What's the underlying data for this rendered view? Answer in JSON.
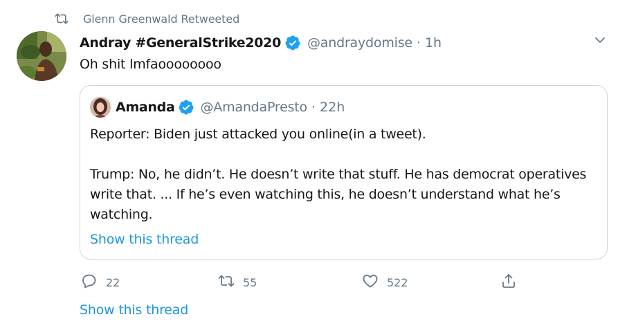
{
  "social_context": {
    "text": "Glenn Greenwald Retweeted",
    "icon": "retweet-icon"
  },
  "tweet": {
    "author_name": "Andray #GeneralStrike2020",
    "handle": "@andraydomise",
    "separator": "·",
    "time": "1h",
    "text": "Oh shit lmfaoooooooo",
    "verified_icon": "verified-badge-icon",
    "more_icon": "chevron-down-icon"
  },
  "quoted_tweet": {
    "author_name": "Amanda",
    "handle": "@AmandaPresto",
    "separator": "·",
    "time": "22h",
    "paragraphs": [
      "Reporter: Biden just attacked you online(in a tweet).",
      "Trump: No, he didn’t. He doesn’t write that stuff. He has democrat operatives write that. ... If he’s even watching this, he doesn’t understand what he’s watching."
    ],
    "show_thread_label": "Show this thread"
  },
  "actions": {
    "reply_count": "22",
    "retweet_count": "55",
    "like_count": "522"
  },
  "show_thread_label": "Show this thread",
  "colors": {
    "text_primary": "#14171a",
    "text_secondary": "#657786",
    "link_blue": "#1b95e0",
    "verified_blue": "#1da1f2",
    "border": "#ccd6dd"
  }
}
